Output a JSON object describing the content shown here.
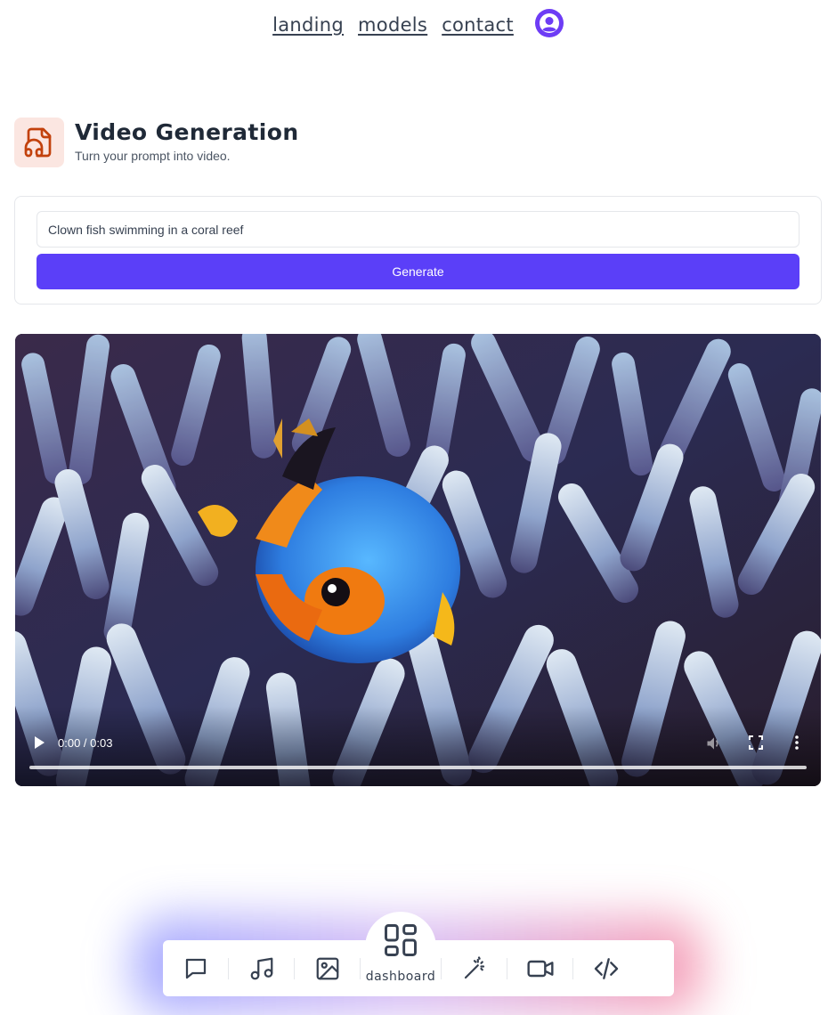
{
  "nav": {
    "links": [
      "landing",
      "models",
      "contact"
    ]
  },
  "header": {
    "title": "Video Generation",
    "subtitle": "Turn your prompt into video.",
    "icon": "music-file-icon"
  },
  "form": {
    "prompt_value": "Clown fish swimming in a coral reef",
    "generate_label": "Generate"
  },
  "video": {
    "time": "0:00 / 0:03",
    "progress": 0
  },
  "dock": {
    "items": [
      "chat-icon",
      "music-icon",
      "image-icon",
      "dashboard-icon",
      "magic-wand-icon",
      "video-icon",
      "code-icon"
    ],
    "center_label": "dashboard"
  },
  "colors": {
    "accent": "#5b3ff8",
    "avatar": "#6d3cf5",
    "header_icon_bg": "#fbe6e1",
    "header_icon": "#c2410c"
  }
}
